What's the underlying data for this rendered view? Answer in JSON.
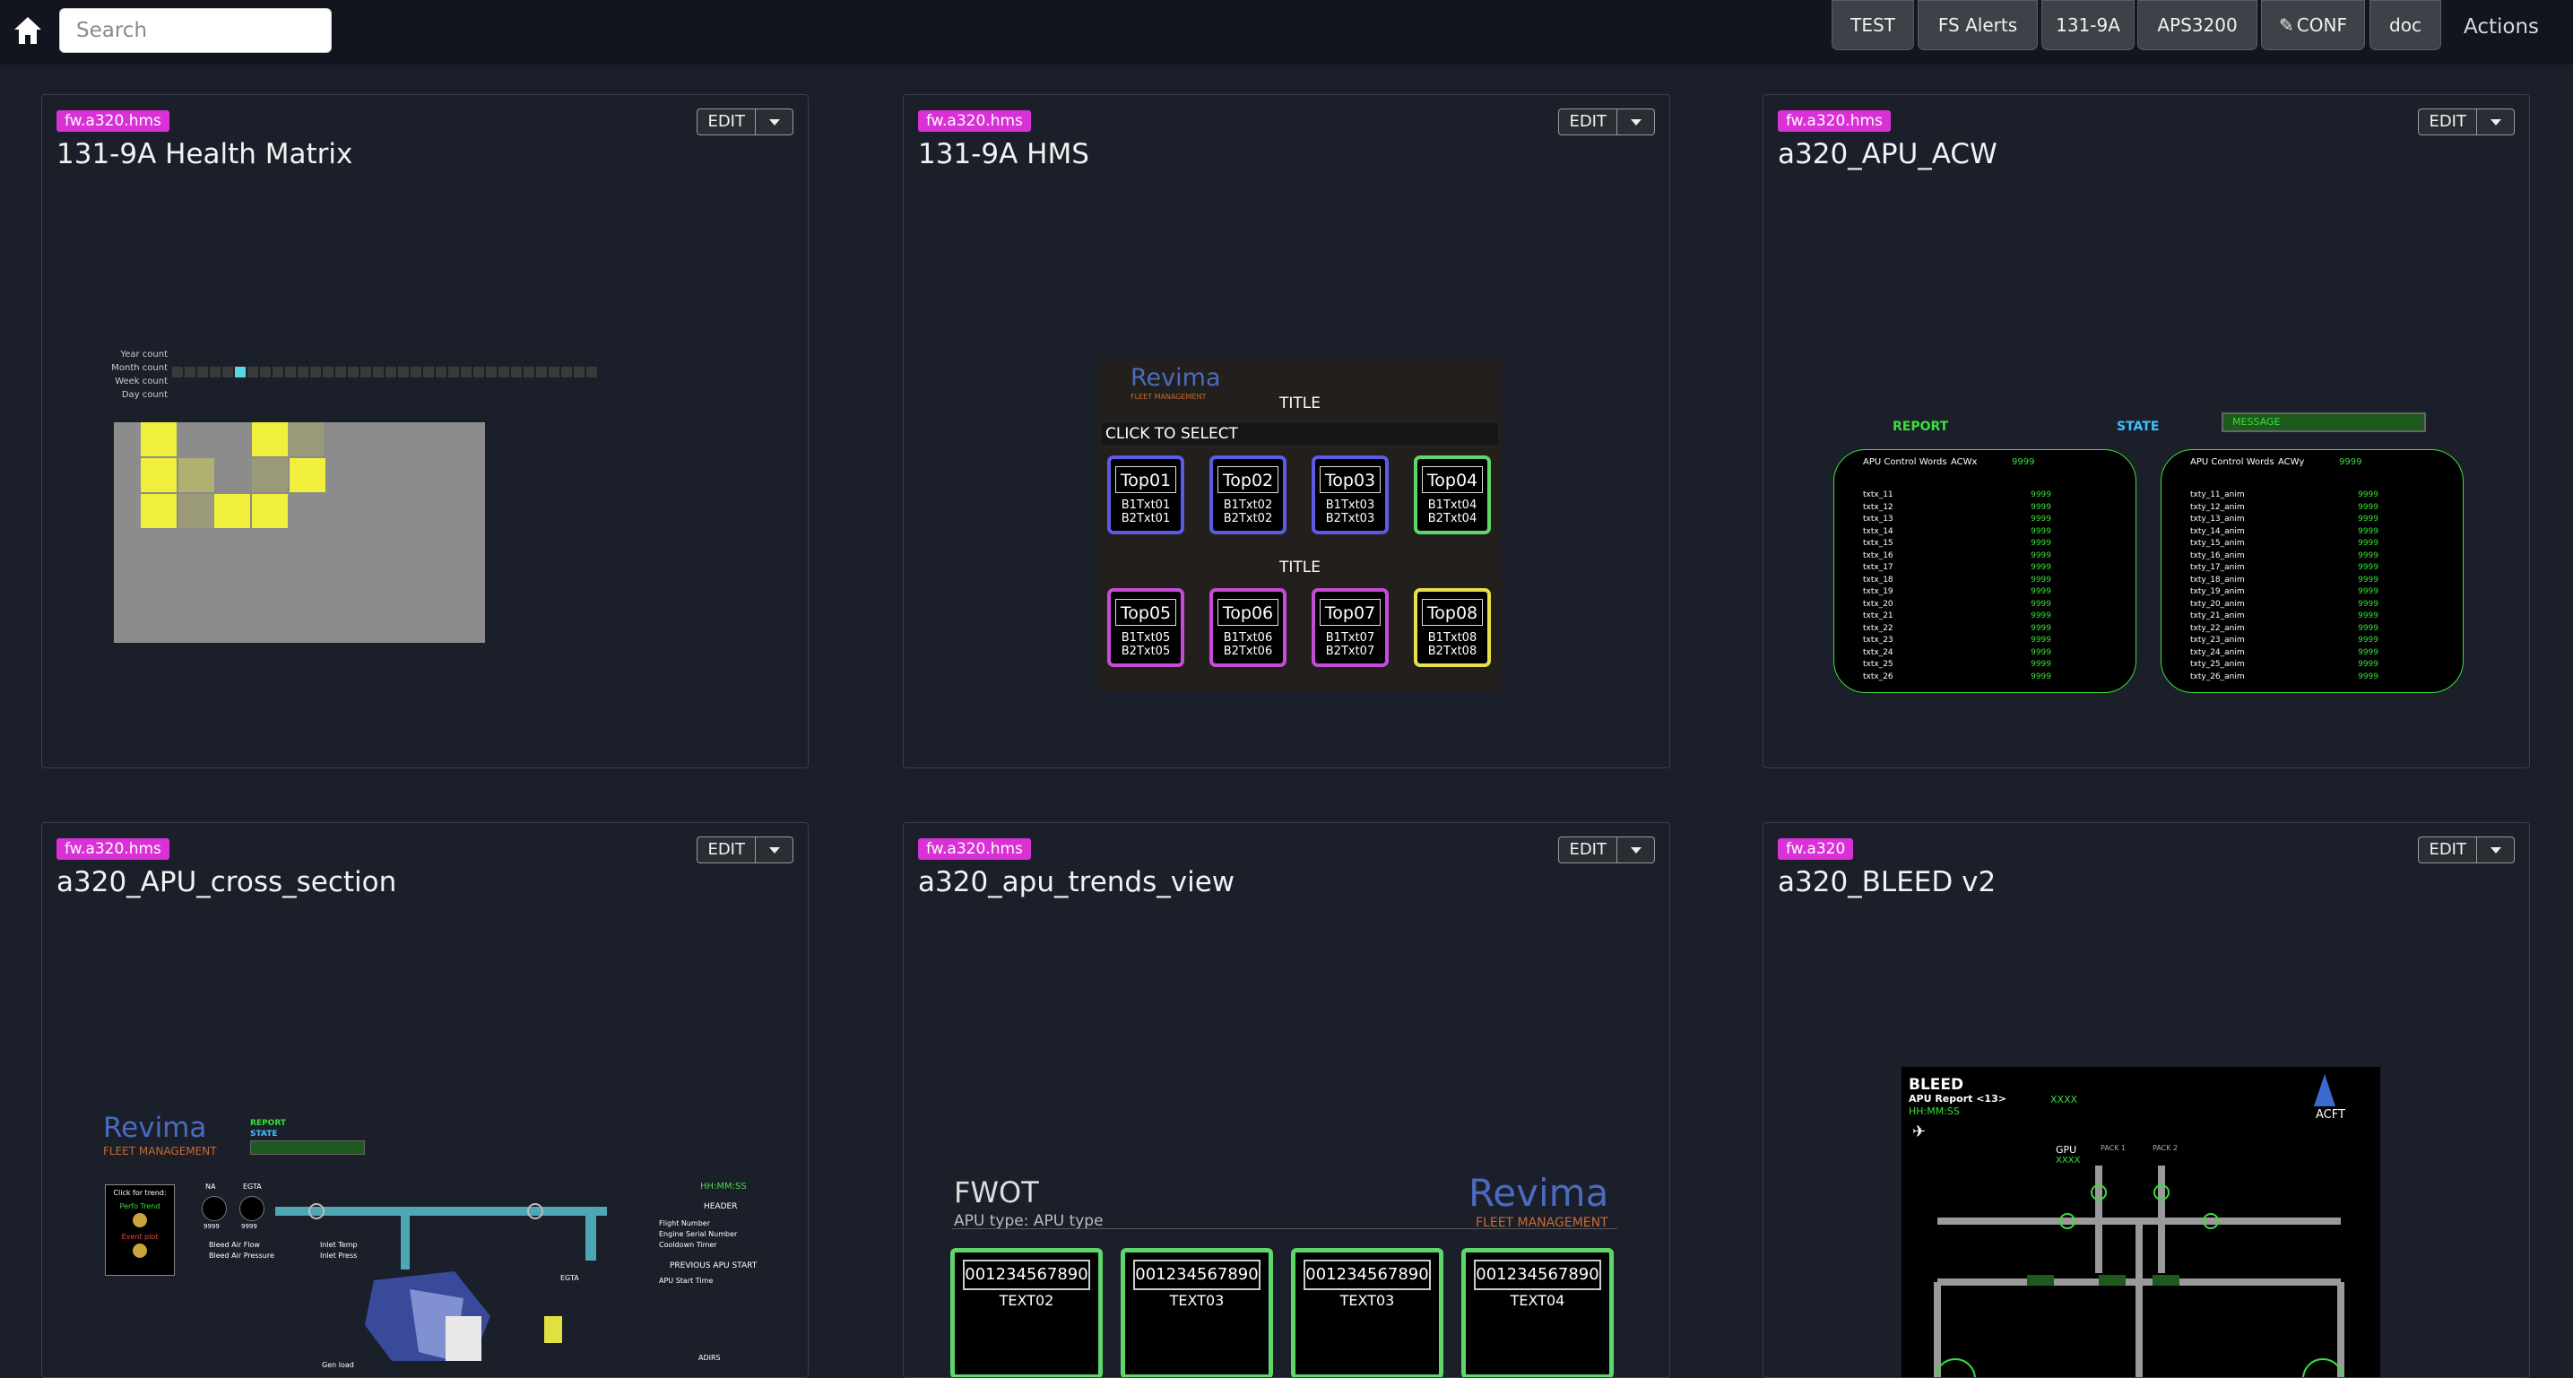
{
  "search": {
    "placeholder": "Search"
  },
  "nav": {
    "buttons": [
      "TEST",
      "FS Alerts",
      "131-9A",
      "APS3200",
      "CONF",
      "doc"
    ],
    "actions_label": "Actions"
  },
  "cards": [
    {
      "tag": "fw.a320.hms",
      "title": "131-9A Health Matrix",
      "edit": "EDIT"
    },
    {
      "tag": "fw.a320.hms",
      "title": "131-9A HMS",
      "edit": "EDIT"
    },
    {
      "tag": "fw.a320.hms",
      "title": "a320_APU_ACW",
      "edit": "EDIT"
    },
    {
      "tag": "fw.a320.hms",
      "title": "a320_APU_cross_section",
      "edit": "EDIT"
    },
    {
      "tag": "fw.a320.hms",
      "title": "a320_apu_trends_view",
      "edit": "EDIT"
    },
    {
      "tag": "fw.a320",
      "title": "a320_BLEED v2",
      "edit": "EDIT"
    }
  ],
  "health": {
    "counts": [
      "Year count",
      "Month count",
      "Week count",
      "Day count"
    ]
  },
  "hms": {
    "brand": "Revima",
    "brand_sub": "FLEET MANAGEMENT",
    "title1": "TITLE",
    "select": "CLICK TO SELECT",
    "title2": "TITLE",
    "tiles": [
      {
        "name": "Top01",
        "t1": "B1Txt01",
        "t2": "B2Txt01",
        "color": "#5b5be6"
      },
      {
        "name": "Top02",
        "t1": "B1Txt02",
        "t2": "B2Txt02",
        "color": "#5b5be6"
      },
      {
        "name": "Top03",
        "t1": "B1Txt03",
        "t2": "B2Txt03",
        "color": "#5b5be6"
      },
      {
        "name": "Top04",
        "t1": "B1Txt04",
        "t2": "B2Txt04",
        "color": "#5fd66a"
      },
      {
        "name": "Top05",
        "t1": "B1Txt05",
        "t2": "B2Txt05",
        "color": "#c64bd8"
      },
      {
        "name": "Top06",
        "t1": "B1Txt06",
        "t2": "B2Txt06",
        "color": "#c64bd8"
      },
      {
        "name": "Top07",
        "t1": "B1Txt07",
        "t2": "B2Txt07",
        "color": "#c64bd8"
      },
      {
        "name": "Top08",
        "t1": "B1Txt08",
        "t2": "B2Txt08",
        "color": "#e8e04a"
      }
    ]
  },
  "acw": {
    "report": "REPORT",
    "state": "STATE",
    "message": "MESSAGE",
    "left": {
      "header": "APU Control Words",
      "word": "ACWx",
      "value": "9999",
      "rows": [
        "txtx_11",
        "txtx_12",
        "txtx_13",
        "txtx_14",
        "txtx_15",
        "txtx_16",
        "txtx_17",
        "txtx_18",
        "txtx_19",
        "txtx_20",
        "txtx_21",
        "txtx_22",
        "txtx_23",
        "txtx_24",
        "txtx_25",
        "txtx_26"
      ],
      "row_value": "9999"
    },
    "right": {
      "header": "APU Control Words",
      "word": "ACWy",
      "value": "9999",
      "rows": [
        "txty_11_anim",
        "txty_12_anim",
        "txty_13_anim",
        "txty_14_anim",
        "txty_15_anim",
        "txty_16_anim",
        "txty_17_anim",
        "txty_18_anim",
        "txty_19_anim",
        "txty_20_anim",
        "txty_21_anim",
        "txty_22_anim",
        "txty_23_anim",
        "txty_24_anim",
        "txty_25_anim",
        "txty_26_anim"
      ],
      "row_value": "9999"
    }
  },
  "cross": {
    "brand": "Revima",
    "brand_sub": "FLEET MANAGEMENT",
    "report": "REPORT",
    "state": "STATE",
    "trend_head": "Click for trend:",
    "perfo": "Perfo Trend",
    "event": "Event plot",
    "na": "NA",
    "egta": "EGTA",
    "na_val": "9999",
    "egta_val": "9999",
    "bleed_flow": "Bleed Air Flow",
    "bleed_press": "Bleed Air Pressure",
    "inlet_temp": "Inlet Temp",
    "inlet_press": "Inlet Press",
    "val": "9999",
    "egta2": "EGTA",
    "gen_load": "Gen load",
    "time": "HH:MM:SS",
    "header": "HEADER",
    "flight": "Flight Number",
    "serial": "Engine Serial Number",
    "cooldown": "Cooldown Timer",
    "prev": "PREVIOUS APU START",
    "start_time": "APU Start Time",
    "adirs": "ADIRS"
  },
  "trends": {
    "title": "FWOT",
    "apu_type": "APU type: APU type",
    "brand": "Revima",
    "brand_sub": "FLEET MANAGEMENT",
    "boxes": [
      {
        "num": "001234567890",
        "text": "TEXT02"
      },
      {
        "num": "001234567890",
        "text": "TEXT03"
      },
      {
        "num": "001234567890",
        "text": "TEXT03"
      },
      {
        "num": "001234567890",
        "text": "TEXT04"
      }
    ]
  },
  "bleed": {
    "title": "BLEED",
    "report": "APU Report <13>",
    "time": "HH:MM:SS",
    "xxxx": "XXXX",
    "acft": "ACFT",
    "gpu": "GPU",
    "gpu_val": "XXXX",
    "pack1": "PACK 1",
    "pack2": "PACK 2"
  }
}
